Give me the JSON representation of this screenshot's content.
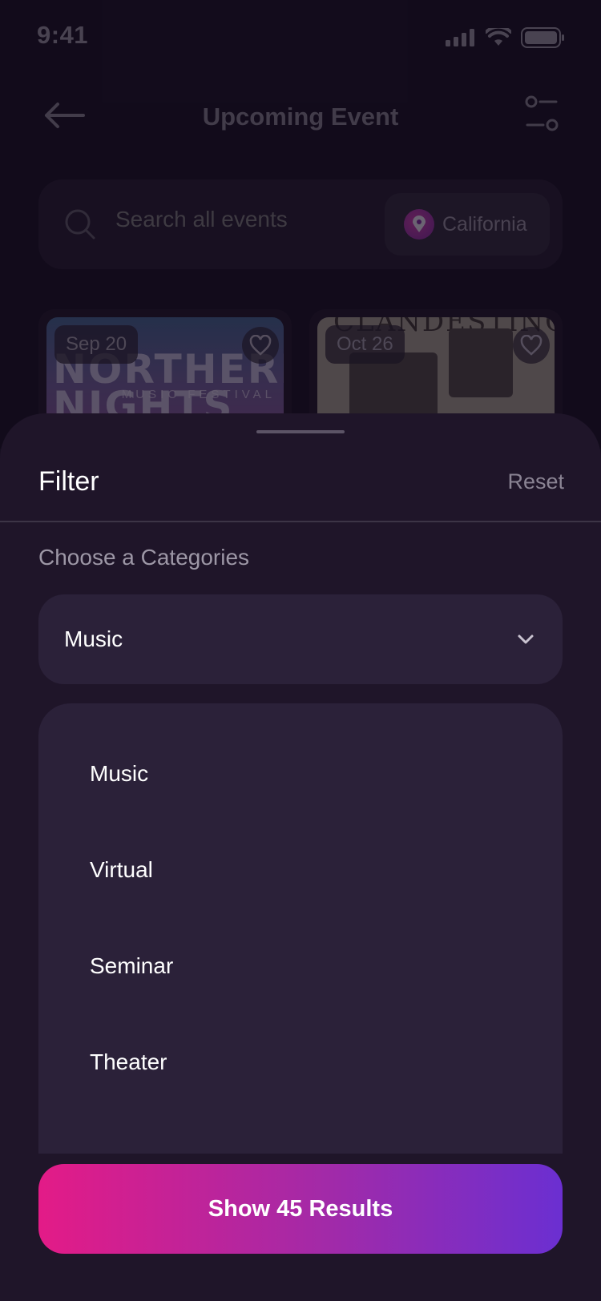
{
  "status": {
    "time": "9:41"
  },
  "header": {
    "title": "Upcoming Event"
  },
  "search": {
    "placeholder": "Search all events",
    "location": "California"
  },
  "events": [
    {
      "date": "Sep 20",
      "poster_text": "NORTHERN NIGHTS",
      "poster_sub": "MUSIC FESTIVAL"
    },
    {
      "date": "Oct 26",
      "poster_text": "CLANDESTINO"
    }
  ],
  "filter": {
    "title": "Filter",
    "reset_label": "Reset",
    "section_label": "Choose a Categories",
    "selected_category": "Music",
    "options": [
      "Music",
      "Virtual",
      "Seminar",
      "Theater"
    ],
    "cta_label": "Show 45 Results"
  },
  "colors": {
    "background": "#140d1d",
    "sheet": "#1f1529",
    "field": "#2b2139",
    "cta_start": "#e31b87",
    "cta_end": "#6b2fd1"
  }
}
